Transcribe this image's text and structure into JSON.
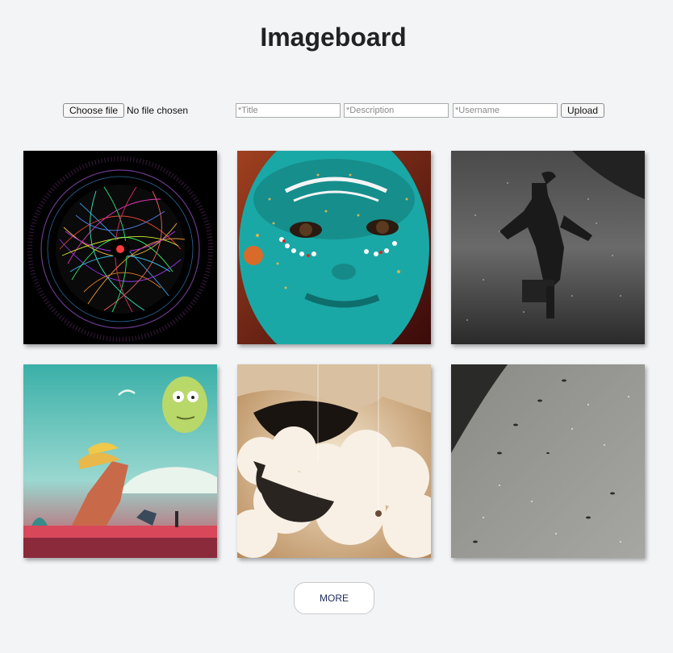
{
  "header": {
    "title": "Imageboard"
  },
  "upload_form": {
    "choose_file_label": "Choose file",
    "file_status": "No file chosen",
    "title_placeholder": "*Title",
    "description_placeholder": "*Description",
    "username_placeholder": "*Username",
    "upload_label": "Upload"
  },
  "gallery": {
    "images": [
      {
        "subject": "colorful circular string art on black"
      },
      {
        "subject": "face painted turquoise with glitter"
      },
      {
        "subject": "black and white figure walking in water"
      },
      {
        "subject": "alien landscape with floating head"
      },
      {
        "subject": "whale among clouds"
      },
      {
        "subject": "snowy slope with footprints"
      }
    ]
  },
  "pagination": {
    "more_label": "MORE"
  },
  "colors": {
    "background": "#f3f4f6",
    "title_text": "#222222",
    "more_text": "#1c2a5a"
  }
}
